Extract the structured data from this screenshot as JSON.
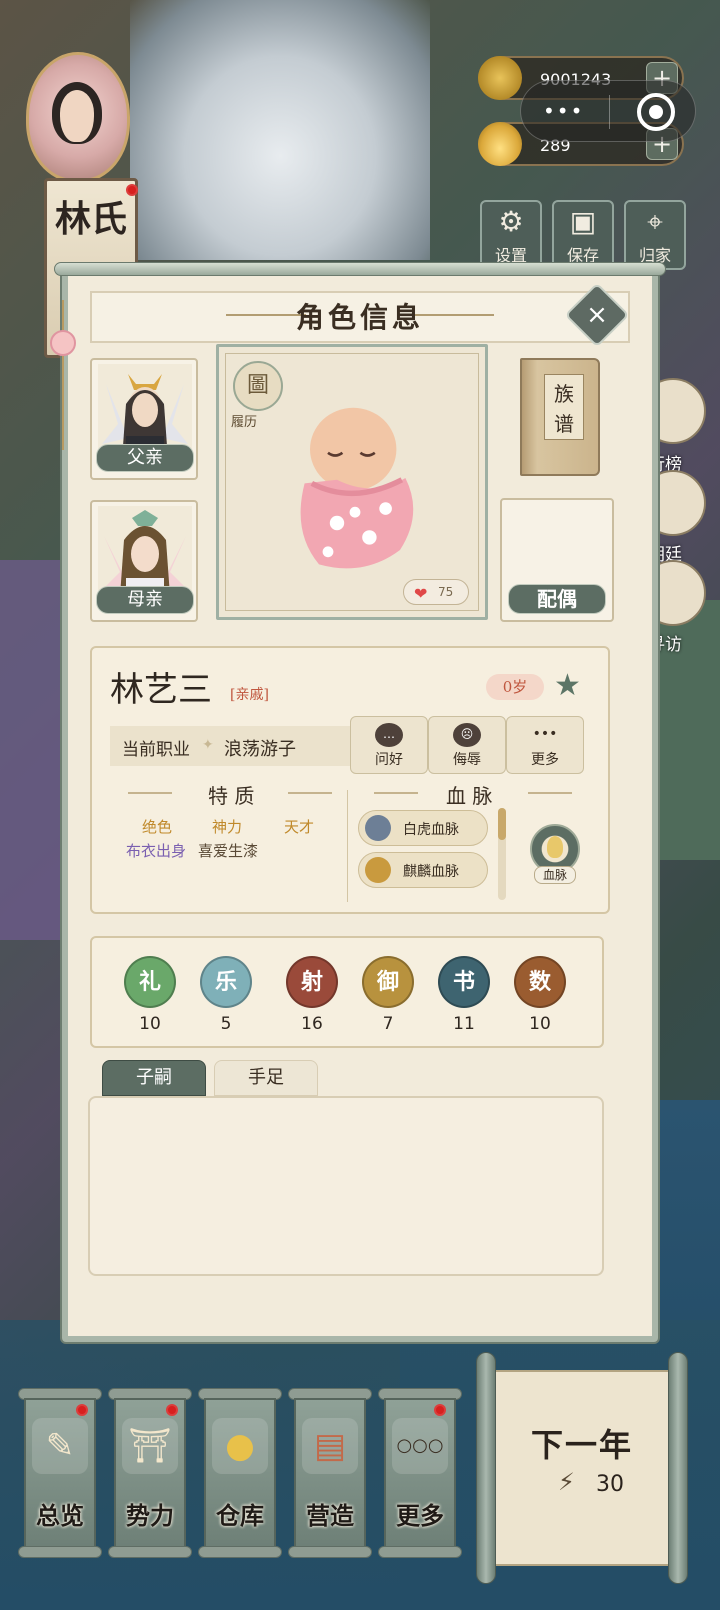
{
  "player": {
    "surname": "林氏"
  },
  "currency": [
    {
      "name": "copper-coins",
      "amount": "9001243",
      "add": "+"
    },
    {
      "name": "gold-ingots",
      "amount": "289",
      "add": "+"
    }
  ],
  "system": {
    "menu_dots": "•••"
  },
  "top_buttons": [
    {
      "icon": "gear-icon",
      "label": "设置",
      "glyph": "⚙"
    },
    {
      "icon": "save-icon",
      "label": "保存",
      "glyph": "▣"
    },
    {
      "icon": "location-pin-icon",
      "label": "归家",
      "glyph": "⌖"
    }
  ],
  "side_menu": [
    {
      "icon": "trophy-icon",
      "label": "行榜"
    },
    {
      "icon": "palace-icon",
      "label": "朝廷"
    },
    {
      "icon": "magnifier-icon",
      "label": "寻访"
    }
  ],
  "modal": {
    "title": "角色信息",
    "close": "×",
    "father_label": "父亲",
    "mother_label": "母亲",
    "resume_label": "履历",
    "resume_glyph": "圖",
    "affection": "75",
    "genealogy_label": "族谱",
    "spouse_label": "配偶"
  },
  "character": {
    "name": "林艺三",
    "relation": "[亲戚]",
    "age": "0岁",
    "job_label": "当前职业",
    "job_sep": "✦",
    "job": "浪荡游子",
    "actions": [
      {
        "icon": "speech-bubble-icon",
        "label": "问好",
        "glyph": "…"
      },
      {
        "icon": "angry-face-icon",
        "label": "侮辱",
        "glyph": "☹"
      },
      {
        "icon": "more-dots-icon",
        "label": "更多",
        "glyph": "•••"
      }
    ]
  },
  "traits": {
    "header": "特 质",
    "items": [
      "绝色",
      "神力",
      "天才",
      "布衣出身",
      "喜爱生漆"
    ]
  },
  "bloodline": {
    "header": "血 脉",
    "items": [
      "白虎血脉",
      "麒麟血脉"
    ],
    "button_label": "血脉"
  },
  "stats": [
    {
      "char": "礼",
      "value": "10",
      "color": "#6aa86a"
    },
    {
      "char": "乐",
      "value": "5",
      "color": "#7fb0b8"
    },
    {
      "char": "射",
      "value": "16",
      "color": "#9a4a3a"
    },
    {
      "char": "御",
      "value": "7",
      "color": "#b8923e"
    },
    {
      "char": "书",
      "value": "11",
      "color": "#3e6470"
    },
    {
      "char": "数",
      "value": "10",
      "color": "#9a5c30"
    }
  ],
  "tabs": [
    "子嗣",
    "手足"
  ],
  "bottom_nav": [
    {
      "icon": "scroll-brush-icon",
      "label": "总览",
      "glyph": "✎",
      "badge": true
    },
    {
      "icon": "palace-icon",
      "label": "势力",
      "glyph": "⛩",
      "badge": true
    },
    {
      "icon": "money-bag-icon",
      "label": "仓库",
      "glyph": "●",
      "badge": false
    },
    {
      "icon": "trowel-bricks-icon",
      "label": "营造",
      "glyph": "▤",
      "badge": false
    },
    {
      "icon": "more-dots-icon",
      "label": "更多",
      "glyph": "○○○",
      "badge": true
    }
  ],
  "next_year": {
    "label": "下一年",
    "energy_icon": "⚡",
    "energy": "30"
  }
}
